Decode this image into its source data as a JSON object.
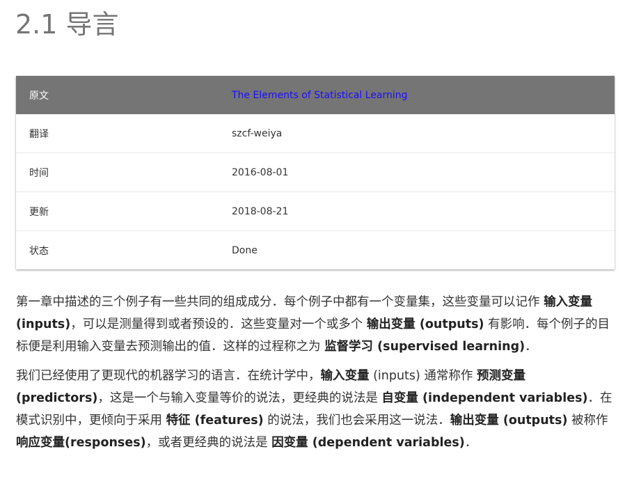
{
  "page": {
    "title": "2.1 导言"
  },
  "info_table": {
    "header": {
      "key": "原文",
      "value": "The Elements of Statistical Learning"
    },
    "rows": [
      {
        "key": "翻译",
        "value": "szcf-weiya"
      },
      {
        "key": "时间",
        "value": "2016-08-01"
      },
      {
        "key": "更新",
        "value": "2018-08-21"
      },
      {
        "key": "状态",
        "value": "Done"
      }
    ]
  },
  "paragraph1": {
    "t1": "第一章中描述的三个例子有一些共同的组成成分．每个例子中都有一个变量集，这些变量可以记作 ",
    "b1": "输入变量 (inputs)",
    "t2": "，可以是测量得到或者预设的．这些变量对一个或多个 ",
    "b2": "输出变量 (outputs)",
    "t3": " 有影响．每个例子的目标便是利用输入变量去预测输出的值．这样的过程称之为 ",
    "b3": "监督学习 (supervised learning)",
    "t4": "．"
  },
  "paragraph2": {
    "t1": "我们已经使用了更现代的机器学习的语言．在统计学中，",
    "b1": "输入变量",
    "t2": " (inputs) 通常称作 ",
    "b2": "预测变量 (predictors)",
    "t3": "，这是一个与输入变量等价的说法，更经典的说法是 ",
    "b3": "自变量 (independent variables)",
    "t4": "．在模式识别中，更倾向于采用 ",
    "b4": "特征 (features)",
    "t5": " 的说法，我们也会采用这一说法．",
    "b5": "输出变量 (outputs)",
    "t6": " 被称作 ",
    "b6": "响应变量(responses)",
    "t7": "，或者更经典的说法是 ",
    "b7": "因变量 (dependent variables)",
    "t8": "．"
  }
}
